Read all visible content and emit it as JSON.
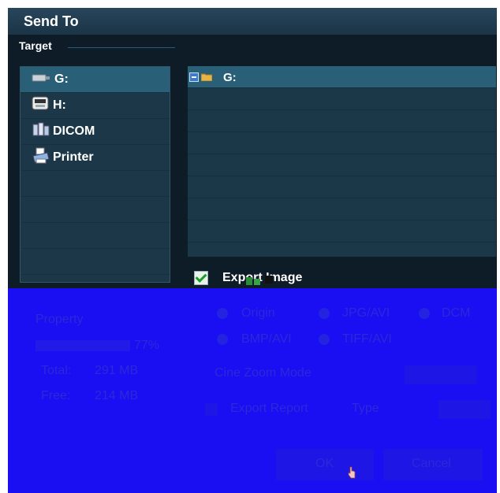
{
  "dialog": {
    "title": "Send To"
  },
  "target": {
    "label": "Target",
    "left_items": [
      {
        "label": "G:",
        "icon": "usb-drive-icon"
      },
      {
        "label": "H:",
        "icon": "dvd-drive-icon"
      },
      {
        "label": "DICOM",
        "icon": "dicom-network-icon"
      },
      {
        "label": "Printer",
        "icon": "printer-icon"
      }
    ],
    "right_items": [
      {
        "label": "G:",
        "icon": "folder-icon"
      }
    ]
  },
  "export_image": {
    "label": "Export Image",
    "checked": true
  },
  "overlay_color": "#1a0ef2",
  "obscured": {
    "property_label": "Property",
    "progress_pct": "77%",
    "progress_value": 0.77,
    "total_label": "Total:",
    "total_value": "291 MB",
    "free_label": "Free:",
    "free_value": "214 MB",
    "formats": [
      "Origin",
      "JPG/AVI",
      "DCM",
      "BMP/AVI",
      "TIFF/AVI"
    ],
    "cine_zoom_label": "Cine Zoom Mode",
    "export_report_label": "Export Report",
    "type_label": "Type",
    "ok_label": "OK",
    "cancel_label": "Cancel"
  }
}
